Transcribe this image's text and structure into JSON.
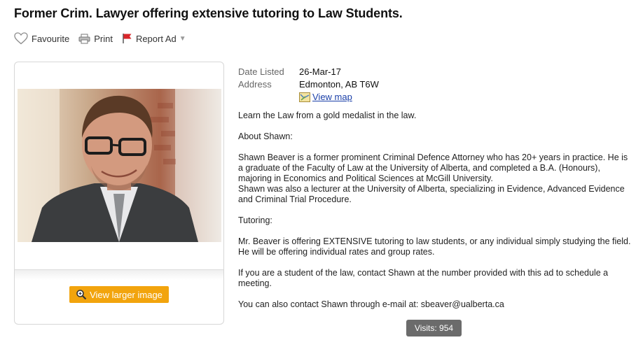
{
  "ad": {
    "title": "Former Crim. Lawyer offering extensive tutoring to Law Students."
  },
  "actions": {
    "favourite": "Favourite",
    "print": "Print",
    "report": "Report Ad"
  },
  "details": {
    "date_label": "Date Listed",
    "date_value": "26-Mar-17",
    "address_label": "Address",
    "address_value": "Edmonton, AB T6W",
    "map_link": "View map"
  },
  "image": {
    "view_larger": "View larger image"
  },
  "description": {
    "p1": "Learn the Law from a gold medalist in the law.",
    "p2": "About Shawn:",
    "p3": "Shawn Beaver is a former prominent Criminal Defence Attorney who has 20+ years in practice. He is a graduate of the Faculty of Law at the University of Alberta, and completed a B.A. (Honours), majoring in Economics and Political Sciences at McGill University.",
    "p3b": "Shawn was also a lecturer at the University of Alberta, specializing in Evidence, Advanced Evidence and Criminal Trial Procedure.",
    "p4": "Tutoring:",
    "p5": "Mr. Beaver is offering EXTENSIVE tutoring to law students, or any individual simply studying the field. He will be offering individual rates and group rates.",
    "p6": "If you are a student of the law, contact Shawn at the number provided with this ad to schedule a meeting.",
    "p7": "You can also contact Shawn through e-mail at: sbeaver@ualberta.ca"
  },
  "stats": {
    "visits": "Visits: 954"
  },
  "colors": {
    "button_orange": "#f2a40d",
    "link_blue": "#1a3fa8",
    "visits_gray": "#6b6b6b",
    "flag_red": "#d9262a"
  },
  "icons": [
    "heart-icon",
    "printer-icon",
    "flag-icon",
    "map-icon",
    "magnifier-icon"
  ]
}
